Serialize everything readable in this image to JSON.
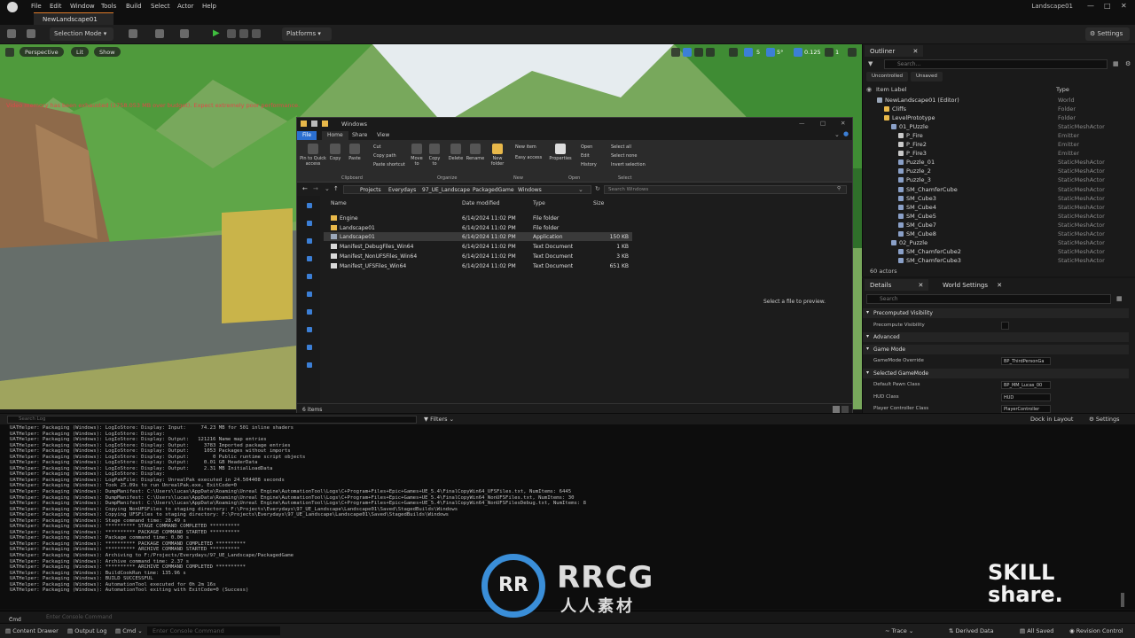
{
  "menubar": {
    "items": [
      "File",
      "Edit",
      "Window",
      "Tools",
      "Build",
      "Select",
      "Actor",
      "Help"
    ],
    "doc_tab": "NewLandscape01",
    "window_title": "Landscape01"
  },
  "toolbar": {
    "selection_mode": "Selection Mode",
    "platforms": "Platforms",
    "settings": "Settings"
  },
  "viewport": {
    "perspective": "Perspective",
    "lit": "Lit",
    "show": "Show",
    "warning": "Video memory has been exhausted (1758.053 MB over budget). Expect extremely poor performance.",
    "grid_value": "5",
    "angle_value": "5°",
    "scale_value": "0.125",
    "camera_speed": "1"
  },
  "explorer": {
    "title": "Windows",
    "tabs": [
      "File",
      "Home",
      "Share",
      "View"
    ],
    "ribbon": {
      "pin": "Pin to Quick access",
      "copy": "Copy",
      "paste": "Paste",
      "cut": "Cut",
      "copy_path": "Copy path",
      "paste_shortcut": "Paste shortcut",
      "move_to": "Move to",
      "copy_to": "Copy to",
      "delete": "Delete",
      "rename": "Rename",
      "new_folder": "New folder",
      "new_item": "New item",
      "easy_access": "Easy access",
      "properties": "Properties",
      "open": "Open",
      "edit": "Edit",
      "history": "History",
      "select_all": "Select all",
      "select_none": "Select none",
      "invert_selection": "Invert selection",
      "groups": [
        "Clipboard",
        "Organize",
        "New",
        "Open",
        "Select"
      ]
    },
    "breadcrumb": [
      "Projects",
      "Everydays",
      "97_UE_Landscape",
      "PackagedGame",
      "Windows"
    ],
    "search_placeholder": "Search Windows",
    "columns": [
      "Name",
      "Date modified",
      "Type",
      "Size"
    ],
    "files": [
      {
        "name": "Engine",
        "date": "6/14/2024 11:02 PM",
        "type": "File folder",
        "size": "",
        "kind": "folder"
      },
      {
        "name": "Landscape01",
        "date": "6/14/2024 11:02 PM",
        "type": "File folder",
        "size": "",
        "kind": "folder"
      },
      {
        "name": "Landscape01",
        "date": "6/14/2024 11:02 PM",
        "type": "Application",
        "size": "150 KB",
        "kind": "app"
      },
      {
        "name": "Manifest_DebugFiles_Win64",
        "date": "6/14/2024 11:02 PM",
        "type": "Text Document",
        "size": "1 KB",
        "kind": "doc"
      },
      {
        "name": "Manifest_NonUFSFiles_Win64",
        "date": "6/14/2024 11:02 PM",
        "type": "Text Document",
        "size": "3 KB",
        "kind": "doc"
      },
      {
        "name": "Manifest_UFSFiles_Win64",
        "date": "6/14/2024 11:02 PM",
        "type": "Text Document",
        "size": "651 KB",
        "kind": "doc"
      }
    ],
    "preview_text": "Select a file to preview.",
    "status": "6 items"
  },
  "outliner": {
    "tab": "Outliner",
    "search_placeholder": "Search...",
    "chips": [
      "Uncontrolled",
      "Unsaved"
    ],
    "col_label": "Item Label",
    "col_type": "Type",
    "rows": [
      {
        "label": "NewLandscape01 (Editor)",
        "type": "World",
        "indent": 0
      },
      {
        "label": "Cliffs",
        "type": "Folder",
        "indent": 1
      },
      {
        "label": "LevelPrototype",
        "type": "Folder",
        "indent": 1
      },
      {
        "label": "01_PUzzle",
        "type": "StaticMeshActor",
        "indent": 2
      },
      {
        "label": "P_Fire",
        "type": "Emitter",
        "indent": 3
      },
      {
        "label": "P_Fire2",
        "type": "Emitter",
        "indent": 3
      },
      {
        "label": "P_Fire3",
        "type": "Emitter",
        "indent": 3
      },
      {
        "label": "Puzzle_01",
        "type": "StaticMeshActor",
        "indent": 3
      },
      {
        "label": "Puzzle_2",
        "type": "StaticMeshActor",
        "indent": 3
      },
      {
        "label": "Puzzle_3",
        "type": "StaticMeshActor",
        "indent": 3
      },
      {
        "label": "SM_ChamferCube",
        "type": "StaticMeshActor",
        "indent": 3
      },
      {
        "label": "SM_Cube3",
        "type": "StaticMeshActor",
        "indent": 3
      },
      {
        "label": "SM_Cube4",
        "type": "StaticMeshActor",
        "indent": 3
      },
      {
        "label": "SM_Cube5",
        "type": "StaticMeshActor",
        "indent": 3
      },
      {
        "label": "SM_Cube7",
        "type": "StaticMeshActor",
        "indent": 3
      },
      {
        "label": "SM_Cube8",
        "type": "StaticMeshActor",
        "indent": 3
      },
      {
        "label": "02_Puzzle",
        "type": "StaticMeshActor",
        "indent": 2
      },
      {
        "label": "SM_ChamferCube2",
        "type": "StaticMeshActor",
        "indent": 3
      },
      {
        "label": "SM_ChamferCube3",
        "type": "StaticMeshActor",
        "indent": 3
      }
    ],
    "count": "60 actors"
  },
  "details": {
    "tab_details": "Details",
    "tab_world": "World Settings",
    "search_placeholder": "Search",
    "sections": [
      {
        "kind": "section",
        "label": "Precomputed Visibility"
      },
      {
        "kind": "prop",
        "label": "Precompute Visibility",
        "value": ""
      },
      {
        "kind": "section",
        "label": "Advanced"
      },
      {
        "kind": "section",
        "label": "Game Mode"
      },
      {
        "kind": "prop",
        "label": "GameMode Override",
        "value": "BP_ThirdPersonGa"
      },
      {
        "kind": "section",
        "label": "Selected GameMode"
      },
      {
        "kind": "prop",
        "label": "Default Pawn Class",
        "value": "BP_MM_Lucas_00"
      },
      {
        "kind": "prop",
        "label": "HUD Class",
        "value": "HUD"
      },
      {
        "kind": "prop",
        "label": "Player Controller Class",
        "value": "PlayerController"
      }
    ]
  },
  "log": {
    "search_placeholder": "Search Log",
    "filters": "Filters",
    "dock": "Dock in Layout",
    "settings": "Settings",
    "lines": [
      "UATHelper: Packaging (Windows): LogIoStore: Display: Input:     74.23 MB for 501 inline shaders",
      "UATHelper: Packaging (Windows): LogIoStore: Display:",
      "UATHelper: Packaging (Windows): LogIoStore: Display: Output:   121216 Name map entries",
      "UATHelper: Packaging (Windows): LogIoStore: Display: Output:     3783 Imported package entries",
      "UATHelper: Packaging (Windows): LogIoStore: Display: Output:     1053 Packages without imports",
      "UATHelper: Packaging (Windows): LogIoStore: Display: Output:        0 Public runtime script objects",
      "UATHelper: Packaging (Windows): LogIoStore: Display: Output:     0.01 GB HeaderData",
      "UATHelper: Packaging (Windows): LogIoStore: Display: Output:     2.31 MB InitialLoadData",
      "UATHelper: Packaging (Windows): LogIoStore: Display:",
      "UATHelper: Packaging (Windows): LogPakFile: Display: UnrealPak executed in 24.504408 seconds",
      "UATHelper: Packaging (Windows): Took 25.09s to run UnrealPak.exe, ExitCode=0",
      "UATHelper: Packaging (Windows): DumpManifest: C:\\Users\\lucas\\AppData\\Roaming\\Unreal Engine\\AutomationTool\\Logs\\C+Program+Files+Epic+Games+UE_5.4\\FinalCopyWin64_UFSFiles.txt, NumItems: 6445",
      "UATHelper: Packaging (Windows): DumpManifest: C:\\Users\\lucas\\AppData\\Roaming\\Unreal Engine\\AutomationTool\\Logs\\C+Program+Files+Epic+Games+UE_5.4\\FinalCopyWin64_NonUFSFiles.txt, NumItems: 30",
      "UATHelper: Packaging (Windows): DumpManifest: C:\\Users\\lucas\\AppData\\Roaming\\Unreal Engine\\AutomationTool\\Logs\\C+Program+Files+Epic+Games+UE_5.4\\FinalCopyWin64_NonUFSFilesDebug.txt, NumItems: 8",
      "UATHelper: Packaging (Windows): Copying NonUFSFiles to staging directory: F:\\Projects\\Everydays\\97_UE_Landscape\\Landscape01\\Saved\\StagedBuilds\\Windows",
      "UATHelper: Packaging (Windows): Copying UFSFiles to staging directory: F:\\Projects\\Everydays\\97_UE_Landscape\\Landscape01\\Saved\\StagedBuilds\\Windows",
      "UATHelper: Packaging (Windows): Stage command time: 28.49 s",
      "UATHelper: Packaging (Windows): ********** STAGE COMMAND COMPLETED **********",
      "UATHelper: Packaging (Windows): ********** PACKAGE COMMAND STARTED **********",
      "UATHelper: Packaging (Windows): Package command time: 0.00 s",
      "UATHelper: Packaging (Windows): ********** PACKAGE COMMAND COMPLETED **********",
      "UATHelper: Packaging (Windows): ********** ARCHIVE COMMAND STARTED **********",
      "UATHelper: Packaging (Windows): Archiving to F:/Projects/Everydays/97_UE_Landscape/PackagedGame",
      "UATHelper: Packaging (Windows): Archive command time: 2.37 s",
      "UATHelper: Packaging (Windows): ********** ARCHIVE COMMAND COMPLETED **********",
      "UATHelper: Packaging (Windows): BuildCookRun time: 135.96 s",
      "UATHelper: Packaging (Windows): BUILD SUCCESSFUL",
      "UATHelper: Packaging (Windows): AutomationTool executed for 0h 2m 16s",
      "UATHelper: Packaging (Windows): AutomationTool exiting with ExitCode=0 (Success)"
    ]
  },
  "console": {
    "cmd": "Cmd",
    "placeholder": "Enter Console Command"
  },
  "statusbar": {
    "content_drawer": "Content Drawer",
    "output_log": "Output Log",
    "cmd": "Cmd",
    "placeholder": "Enter Console Command",
    "trace": "Trace",
    "derived_data": "Derived Data",
    "all_saved": "All Saved",
    "revision_control": "Revision Control"
  },
  "watermarks": {
    "rrcg_mark": "RR",
    "rrcg": "RRCG",
    "rrcg_cn": "人人素材",
    "skillshare_1": "SKILL",
    "skillshare_2": "share."
  },
  "colors": {
    "accent_orange": "#e07b2b",
    "play_green": "#3fbf3f",
    "folder_yellow": "#e8b84a",
    "selection_blue": "#3c7fd6",
    "warning_red": "#e04848"
  }
}
